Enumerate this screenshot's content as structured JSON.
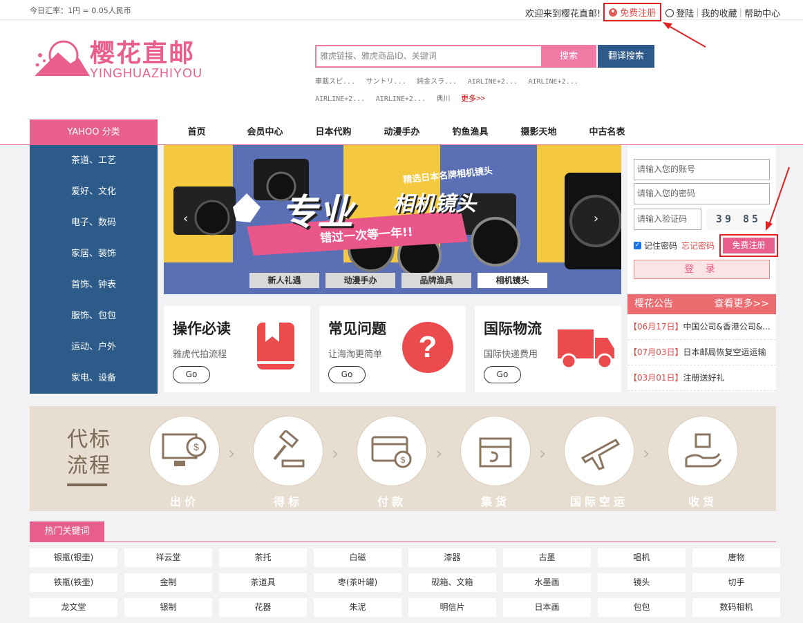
{
  "topbar": {
    "rate": "今日汇率：1円 = 0.05人民币",
    "welcome": "欢迎来到樱花直邮!",
    "register": "免费注册",
    "login": "登陆",
    "favorites": "我的收藏",
    "help": "帮助中心"
  },
  "logo": {
    "cn": "樱花直邮",
    "en": "YINGHUAZHIYOU"
  },
  "search": {
    "placeholder": "雅虎链接、雅虎商品ID、关键词",
    "button": "搜索",
    "translate_button": "翻译搜索",
    "hot": [
      "車載スピ...",
      "サントリ...",
      "純金スラ...",
      "AIRLINE+2...",
      "AIRLINE+2...",
      "AIRLINE+2...",
      "AIRLINE+2...",
      "典川"
    ],
    "more": "更多>>"
  },
  "nav": {
    "category": "YAHOO 分类",
    "items": [
      "首页",
      "会员中心",
      "日本代购",
      "动漫手办",
      "钓鱼渔具",
      "摄影天地",
      "中古名表"
    ]
  },
  "sidebar": [
    "茶道、工艺",
    "爱好、文化",
    "电子、数码",
    "家居、装饰",
    "首饰、钟表",
    "服饰、包包",
    "运动、户外",
    "家电、设备"
  ],
  "banner": {
    "headline": "专业",
    "headline2": "相机镜头",
    "sub": "精选日本名牌相机镜头",
    "slogan": "错过一次等一年!!",
    "tabs": [
      "新人礼遇",
      "动漫手办",
      "品牌渔具",
      "相机镜头"
    ],
    "prev": "‹",
    "next": "›"
  },
  "cards": [
    {
      "title": "操作必读",
      "sub": "雅虎代拍流程",
      "go": "Go"
    },
    {
      "title": "常见问题",
      "sub": "让海淘更简单",
      "go": "Go"
    },
    {
      "title": "国际物流",
      "sub": "国际快递费用",
      "go": "Go"
    }
  ],
  "login": {
    "account_placeholder": "请输入您的账号",
    "password_placeholder": "请输入您的密码",
    "captcha_placeholder": "请输入验证码",
    "captcha_text": "39 85",
    "remember": "记住密码",
    "forgot": "忘记密码",
    "register": "免费注册",
    "submit": "登 录"
  },
  "notice": {
    "title": "樱花公告",
    "more": "查看更多>>",
    "items": [
      {
        "date": "【06月17日】",
        "text": "中国公司&香港公司&..."
      },
      {
        "date": "【07月03日】",
        "text": "日本邮局恢复空运运输"
      },
      {
        "date": "【03月01日】",
        "text": "注册送好礼"
      }
    ]
  },
  "process": {
    "title_line1": "代标",
    "title_line2": "流程",
    "steps": [
      "出价",
      "得标",
      "付款",
      "集货",
      "国际空运",
      "收货"
    ]
  },
  "keywords": {
    "title": "热门关键词",
    "items": [
      "银瓶(银壶)",
      "祥云堂",
      "茶托",
      "白磁",
      "漆器",
      "古墨",
      "唱机",
      "唐物",
      "铁瓶(铁壶)",
      "金制",
      "茶道具",
      "枣(茶叶罐)",
      "砚箱、文箱",
      "水墨画",
      "镜头",
      "切手",
      "龙文堂",
      "银制",
      "花器",
      "朱泥",
      "明信片",
      "日本画",
      "包包",
      "数码相机"
    ]
  },
  "colors": {
    "pink": "#e85e8c",
    "blue": "#2c5b8a",
    "red": "#e02020"
  }
}
